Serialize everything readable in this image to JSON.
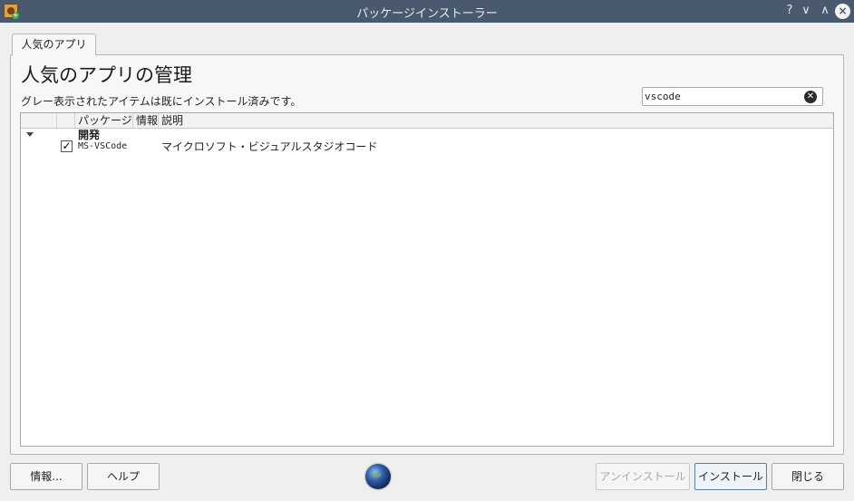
{
  "window": {
    "title": "パッケージインストーラー",
    "help_glyph": "?",
    "minimize_glyph": "∨",
    "maximize_glyph": "∧",
    "close_glyph": "×"
  },
  "tabs": [
    {
      "label": "人気のアプリ",
      "active": true
    }
  ],
  "main": {
    "title": "人気のアプリの管理",
    "subtitle": "グレー表示されたアイテムは既にインストール済みです。"
  },
  "search": {
    "value": "vscode",
    "clear_glyph": "✕"
  },
  "tree": {
    "columns": [
      "",
      "",
      "パッケージ",
      "情報",
      "説明"
    ],
    "groups": [
      {
        "category": "開発",
        "expanded": true,
        "items": [
          {
            "checked": true,
            "check_glyph": "✓",
            "package": "MS-VSCode",
            "info": "",
            "description": "マイクロソフト・ビジュアルスタジオコード"
          }
        ]
      }
    ]
  },
  "buttons": {
    "info": "情報...",
    "help": "ヘルプ",
    "uninstall": "アンインストール",
    "install": "インストール",
    "close": "閉じる"
  },
  "colors": {
    "titlebar": "#4a5a6e",
    "background": "#efefef"
  }
}
